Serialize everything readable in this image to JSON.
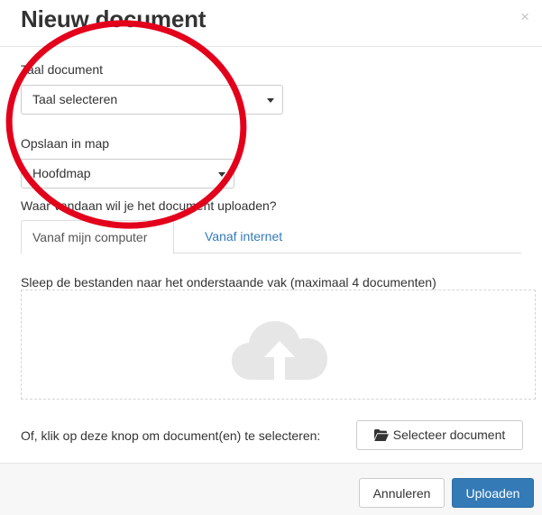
{
  "modal": {
    "title": "Nieuw document",
    "close_glyph": "×"
  },
  "language": {
    "label": "Taal document",
    "selected": "Taal selecteren"
  },
  "folder": {
    "label": "Opslaan in map",
    "selected": "Hoofdmap"
  },
  "source": {
    "question": "Waar vandaan wil je het document uploaden?",
    "tabs": [
      {
        "label": "Vanaf mijn computer",
        "active": true
      },
      {
        "label": "Vanaf internet",
        "active": false
      }
    ]
  },
  "dropzone": {
    "instruction": "Sleep de bestanden naar het onderstaande vak (maximaal 4 documenten)",
    "icon": "cloud-upload-icon"
  },
  "select_row": {
    "text": "Of, klik op deze knop om document(en) te selecteren:",
    "button_label": "Selecteer document",
    "button_icon": "folder-open-icon"
  },
  "footer": {
    "cancel_label": "Annuleren",
    "upload_label": "Uploaden"
  },
  "colors": {
    "primary": "#337ab7",
    "link": "#337ab7",
    "annotation": "#e3001b"
  }
}
